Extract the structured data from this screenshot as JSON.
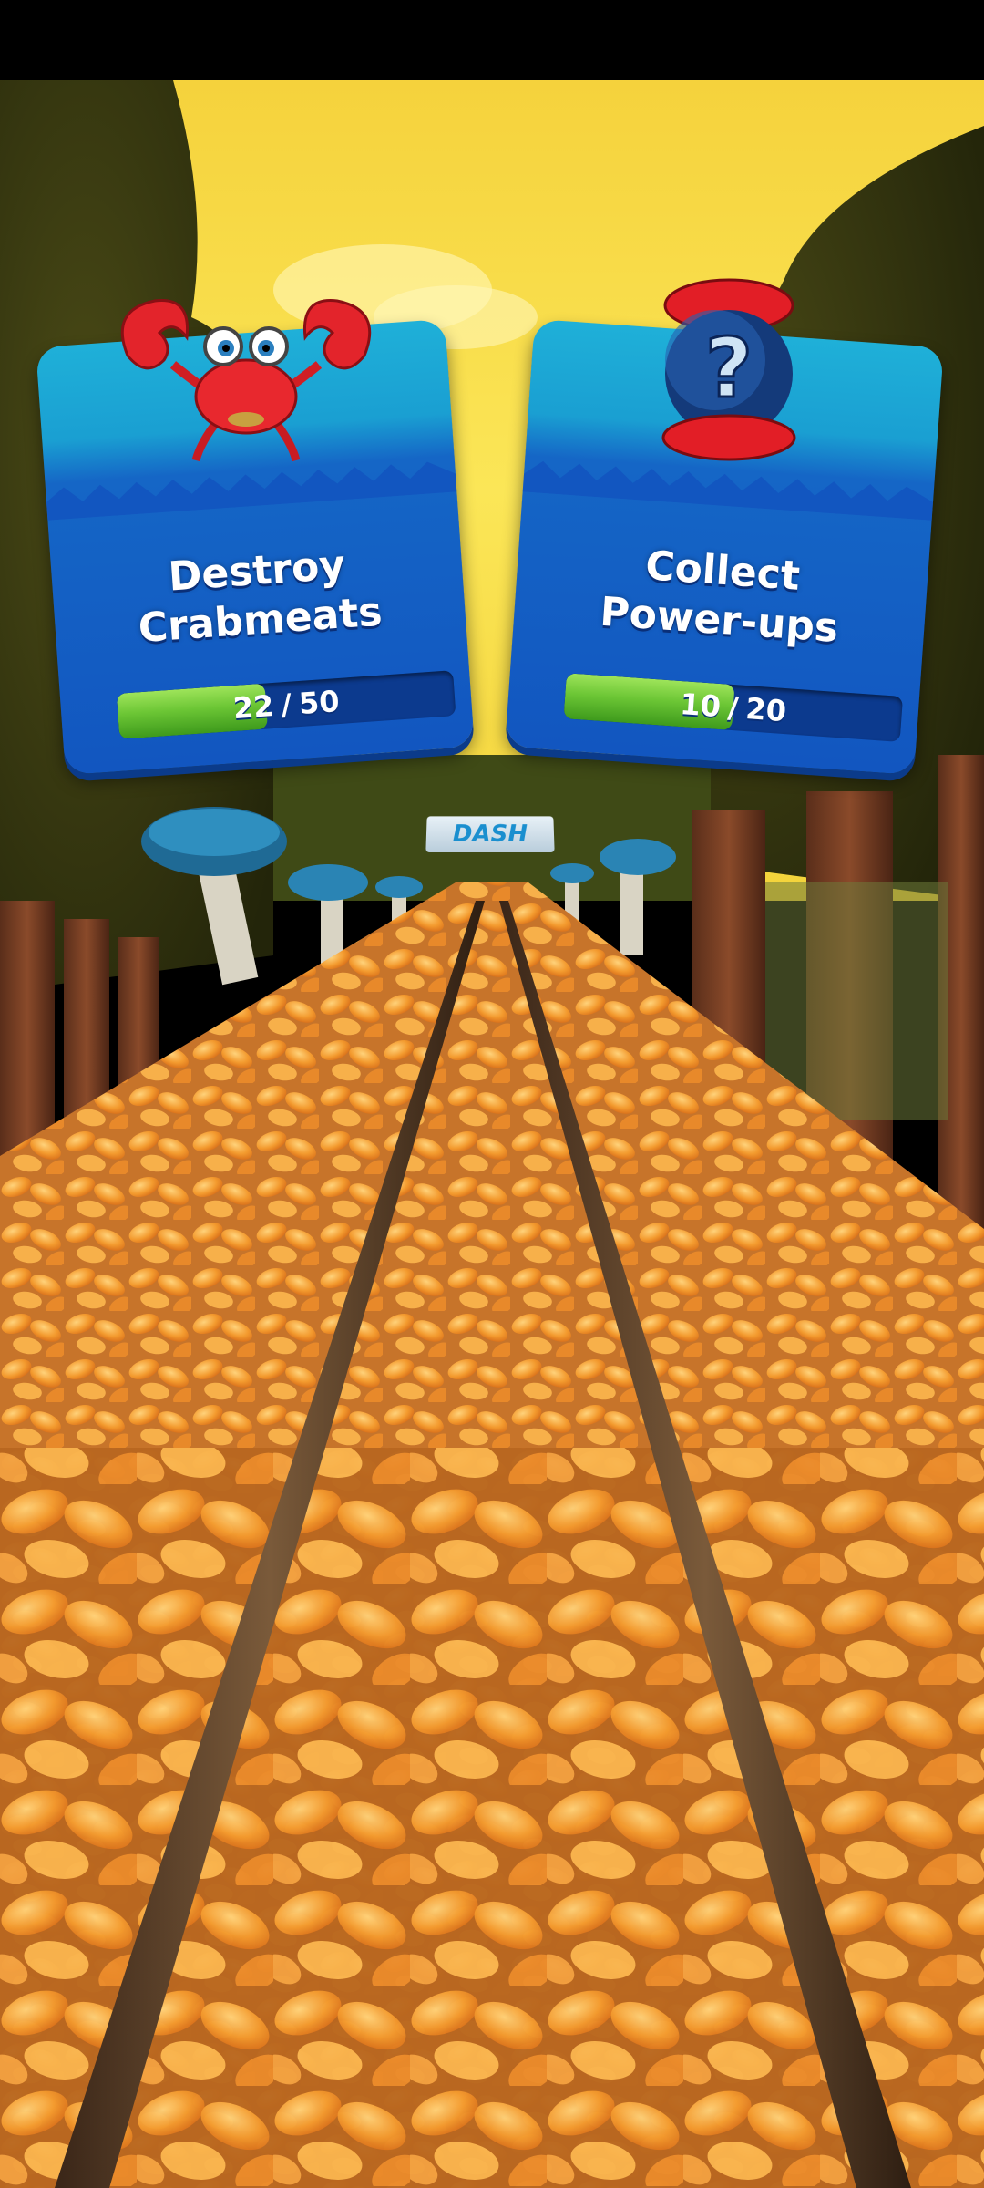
{
  "game": {
    "sign_text": "DASH"
  },
  "missions": [
    {
      "title_line1": "Destroy",
      "title_line2": "Crabmeats",
      "progress_current": "22",
      "progress_separator": "/",
      "progress_total": "50",
      "progress_fraction": 0.44,
      "icon": "crab-icon"
    },
    {
      "title_line1": "Collect",
      "title_line2": "Power-ups",
      "progress_current": "10",
      "progress_separator": "/",
      "progress_total": "20",
      "progress_fraction": 0.5,
      "icon": "mystery-powerup-icon"
    }
  ],
  "colors": {
    "card_top": "#1fb0d8",
    "card_bottom": "#1256c0",
    "progress_green": "#6cc635",
    "sky": "#f7dc3a",
    "leaves": "#f0a030"
  }
}
